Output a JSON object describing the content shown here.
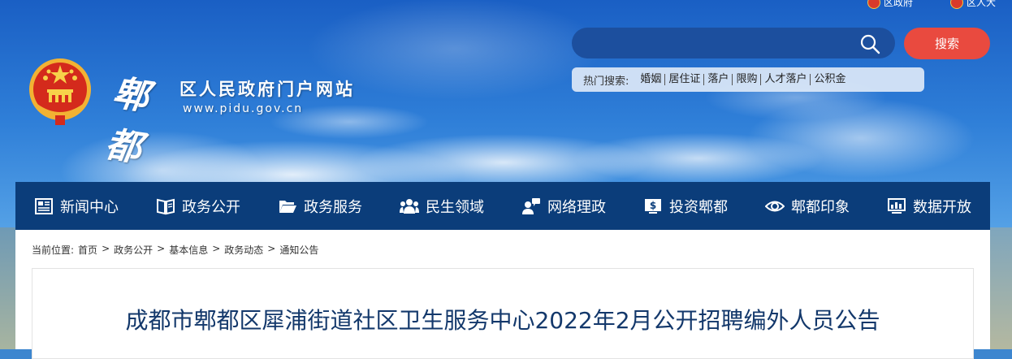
{
  "top_links": [
    {
      "label": "区政府",
      "icon": "emblem-icon"
    },
    {
      "label": "区人大",
      "icon": "emblem-icon"
    }
  ],
  "site": {
    "calligraphy": "郫都",
    "title": "区人民政府门户网站",
    "url": "www.pidu.gov.cn"
  },
  "search": {
    "placeholder": "",
    "button_label": "搜索",
    "hot_label": "热门搜索:",
    "hot_keywords": [
      "婚姻",
      "居住证",
      "落户",
      "限购",
      "人才落户",
      "公积金"
    ]
  },
  "nav": [
    {
      "label": "新闻中心",
      "icon": "newspaper-icon"
    },
    {
      "label": "政务公开",
      "icon": "book-icon"
    },
    {
      "label": "政务服务",
      "icon": "folder-icon"
    },
    {
      "label": "民生领域",
      "icon": "people-icon"
    },
    {
      "label": "网络理政",
      "icon": "chat-user-icon"
    },
    {
      "label": "投资郫都",
      "icon": "dollar-icon"
    },
    {
      "label": "郫都印象",
      "icon": "eye-icon"
    },
    {
      "label": "数据开放",
      "icon": "data-icon"
    }
  ],
  "breadcrumb": {
    "prefix": "当前位置:",
    "items": [
      "首页",
      "政务公开",
      "基本信息",
      "政务动态",
      "通知公告"
    ],
    "separator": ">"
  },
  "article": {
    "title": "成都市郫都区犀浦街道社区卫生服务中心2022年2月公开招聘编外人员公告"
  },
  "colors": {
    "nav_bg": "#0b3d7a",
    "search_button": "#e94a3f",
    "title": "#13386b"
  }
}
